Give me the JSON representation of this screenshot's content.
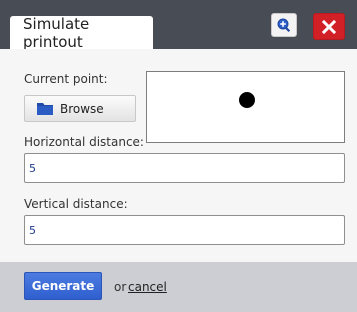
{
  "dialog": {
    "tab_title": "Simulate printout",
    "zoom_icon": "magnifier-plus-icon",
    "close_icon": "close-icon"
  },
  "form": {
    "current_point_label": "Current point:",
    "browse_label": "Browse",
    "horizontal_label": "Horizontal distance:",
    "horizontal_value": "5",
    "vertical_label": "Vertical distance:",
    "vertical_value": "5"
  },
  "footer": {
    "generate_label": "Generate",
    "or_text": "or",
    "cancel_label": "cancel"
  },
  "colors": {
    "titlebar": "#484c55",
    "close": "#d22027",
    "generate": "#2f5fcf"
  }
}
